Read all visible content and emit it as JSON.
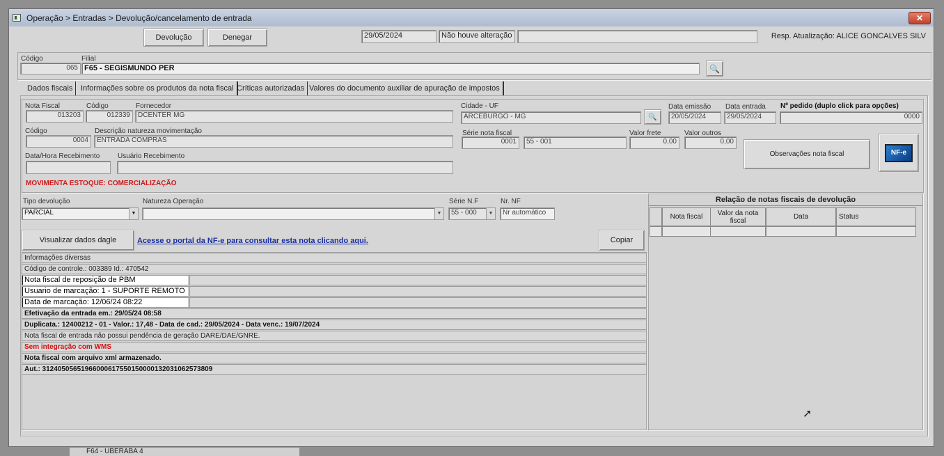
{
  "window": {
    "title": "Operação > Entradas > Devolução/cancelamento de entrada",
    "close": "✕"
  },
  "toolbar": {
    "devolucao": "Devolução",
    "denegar": "Denegar",
    "date": "29/05/2024",
    "status": "Não houve alteração",
    "resp": "Resp. Atualização: ALICE GONCALVES SILV"
  },
  "filial": {
    "codigo_label": "Código",
    "codigo": "065",
    "filial_label": "Filial",
    "filial": "F65 - SEGISMUNDO PER"
  },
  "tabs": [
    "Dados fiscais",
    "Informações sobre os produtos da nota fiscal",
    "Críticas autorizadas",
    "Valores do documento auxiliar de apuração de impostos"
  ],
  "fiscal": {
    "nota_label": "Nota Fiscal",
    "nota": "013203",
    "codigo_label": "Código",
    "codigo": "012339",
    "fornecedor_label": "Fornecedor",
    "fornecedor": "DCENTER MG",
    "codigo2_label": "Código",
    "codigo2": "0004",
    "descricao_label": "Descrição natureza movimentação",
    "descricao": "ENTRADA COMPRAS",
    "data_receb_label": "Data/Hora Recebimento",
    "usuario_receb_label": "Usuário Recebimento",
    "movimenta": "MOVIMENTA ESTOQUE:  COMERCIALIZAÇÃO",
    "cidade_label": "Cidade - UF",
    "cidade": "ARCEBURGO - MG",
    "emissao_label": "Data emissão",
    "emissao": "20/05/2024",
    "entrada_label": "Data entrada",
    "entrada": "29/05/2024",
    "pedido_label": "Nº pedido (duplo click para opções)",
    "pedido": "0000",
    "serie_label": "Série nota fiscal",
    "serie_code": "0001",
    "serie": "55 - 001",
    "frete_label": "Valor frete",
    "frete": "0,00",
    "outros_label": "Valor outros",
    "outros": "0,00",
    "observacoes": "Observações nota fiscal",
    "nfe_icon": "NF-e"
  },
  "devolucao": {
    "tipo_label": "Tipo devolução",
    "tipo": "PARCIAL",
    "natureza_label": "Natureza Operação",
    "natureza": "",
    "serie_label": "Série N.F",
    "serie": "55 - 000",
    "nr_label": "Nr. NF",
    "nr": "Nr automático"
  },
  "actions": {
    "visualizar": "Visualizar dados dagle",
    "link": "Acesse o portal da NF-e para consultar esta nota clicando aqui.",
    "copiar": "Copiar"
  },
  "info": [
    {
      "text": "Informações diversas",
      "style": ""
    },
    {
      "text": "Código de controle.: 003389 Id.: 470542",
      "style": ""
    },
    {
      "text": "Nota fiscal de reposição de PBM",
      "style": "w"
    },
    {
      "text": "Usuario de marcação: 1 - SUPORTE REMOTO",
      "style": "w"
    },
    {
      "text": "Data de marcação: 12/06/24 08:22",
      "style": "w"
    },
    {
      "text": "Efetivação da entrada em.: 29/05/24 08:58",
      "style": "b"
    },
    {
      "text": "Duplicata.: 12400212 - 01 - Valor.: 17,48 - Data de cad.: 29/05/2024 - Data venc.: 19/07/2024",
      "style": "b"
    },
    {
      "text": "Nota fiscal de entrada não possui pendência de geração DARE/DAE/GNRE.",
      "style": ""
    },
    {
      "text": "Sem integração com WMS",
      "style": "red"
    },
    {
      "text": "Nota fiscal com arquivo xml armazenado.",
      "style": "b"
    },
    {
      "text": "Aut.: 31240505651966000617550150000132031062573809",
      "style": "b"
    }
  ],
  "relacao": {
    "title": "Relação de notas fiscais de devolução",
    "columns": [
      "Nota fiscal",
      "Valor da nota fiscal",
      "Data",
      "Status"
    ]
  },
  "background": {
    "filial_row": "F64 - UBERABA 4"
  }
}
